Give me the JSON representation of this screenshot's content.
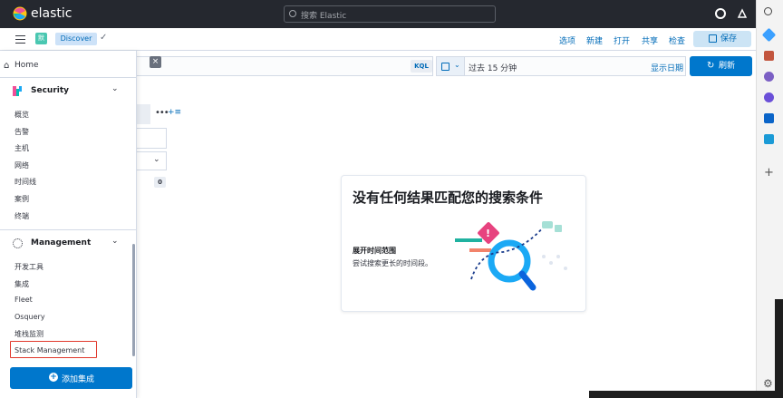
{
  "header": {
    "app_name": "elastic",
    "search_placeholder": "搜索 Elastic"
  },
  "subheader": {
    "space_initial": "默",
    "breadcrumb": "Discover",
    "menu": [
      "选项",
      "新建",
      "打开",
      "共享",
      "检查"
    ],
    "save_label": "保存"
  },
  "querybar": {
    "language": "KQL",
    "time_range": "过去 15 分钟",
    "show_dates": "显示日期",
    "refresh_label": "刷新"
  },
  "background": {
    "hits_count": "0"
  },
  "empty_state": {
    "title": "没有任何结果匹配您的搜索条件",
    "subtitle": "展开时间范围",
    "hint": "尝试搜索更长的时间段。"
  },
  "nav": {
    "home": "Home",
    "security": {
      "title": "Security",
      "items": [
        "概览",
        "告警",
        "主机",
        "网络",
        "时间线",
        "案例",
        "终端"
      ]
    },
    "management": {
      "title": "Management",
      "items": [
        "开发工具",
        "集成",
        "Fleet",
        "Osquery",
        "堆栈监测",
        "Stack Management"
      ]
    },
    "add_integrations": "添加集成"
  },
  "colors": {
    "brand_blue": "#0077cc",
    "header_dark": "#25282f",
    "highlight_red": "#e0382c"
  }
}
